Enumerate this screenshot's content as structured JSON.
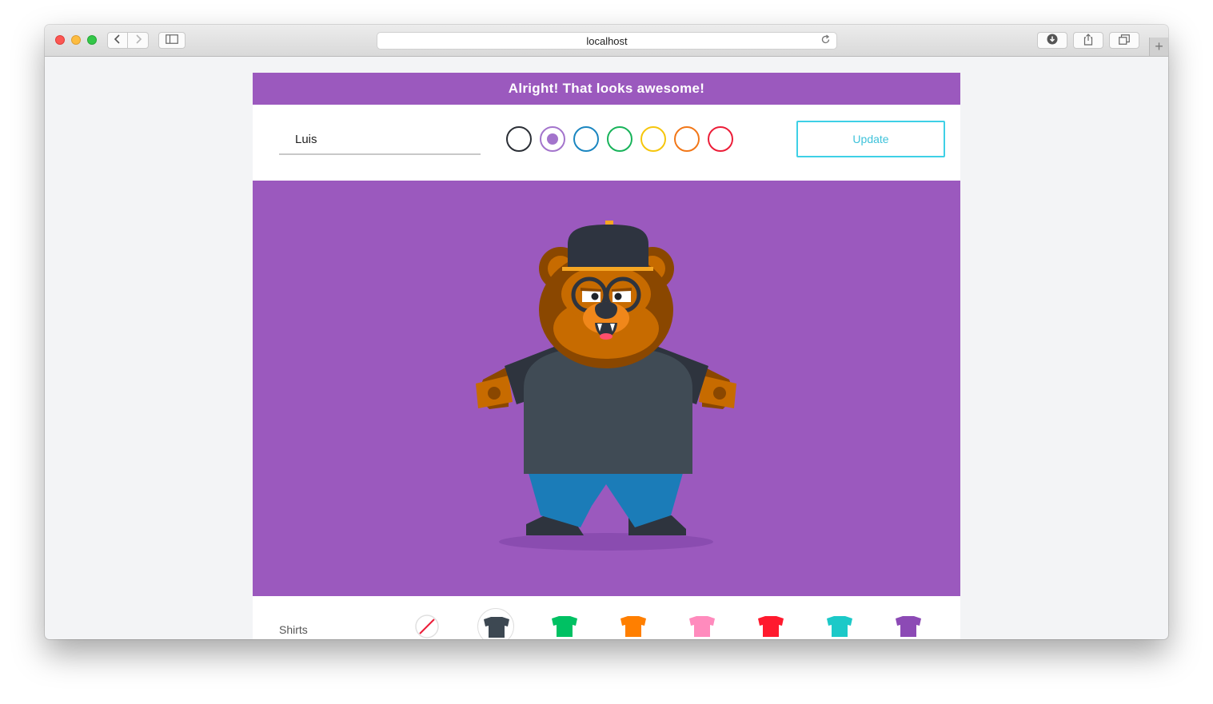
{
  "browser": {
    "url": "localhost"
  },
  "banner": {
    "message": "Alright! That looks awesome!"
  },
  "controls": {
    "name_value": "Luis",
    "update_label": "Update",
    "colors": [
      {
        "name": "black",
        "hex": "#2b2f36",
        "selected": false
      },
      {
        "name": "purple",
        "hex": "#a374cc",
        "selected": true
      },
      {
        "name": "blue",
        "hex": "#1b86c0",
        "selected": false
      },
      {
        "name": "green",
        "hex": "#18b35a",
        "selected": false
      },
      {
        "name": "yellow",
        "hex": "#f6c60c",
        "selected": false
      },
      {
        "name": "orange",
        "hex": "#f27718",
        "selected": false
      },
      {
        "name": "red",
        "hex": "#ec1d38",
        "selected": false
      }
    ]
  },
  "stage": {
    "background": "#9b59be",
    "bear": {
      "fur": "#c76b00",
      "fur_dark": "#8a4700",
      "cap": "#2e3440",
      "cap_band": "#f6a623",
      "shirt": "#404b55",
      "pants": "#1b7cb8",
      "shoes": "#2e343e"
    }
  },
  "items": {
    "section_label": "Shirts",
    "shirts": [
      {
        "name": "none",
        "hex": "none",
        "selected": false
      },
      {
        "name": "gray",
        "hex": "#3d4852",
        "selected": true
      },
      {
        "name": "green",
        "hex": "#00c163",
        "selected": false
      },
      {
        "name": "orange",
        "hex": "#ff7f00",
        "selected": false
      },
      {
        "name": "pink",
        "hex": "#ff8bbd",
        "selected": false
      },
      {
        "name": "red",
        "hex": "#ff1a2e",
        "selected": false
      },
      {
        "name": "teal",
        "hex": "#1cc9c8",
        "selected": false
      },
      {
        "name": "purple",
        "hex": "#8c4ab5",
        "selected": false
      }
    ]
  }
}
